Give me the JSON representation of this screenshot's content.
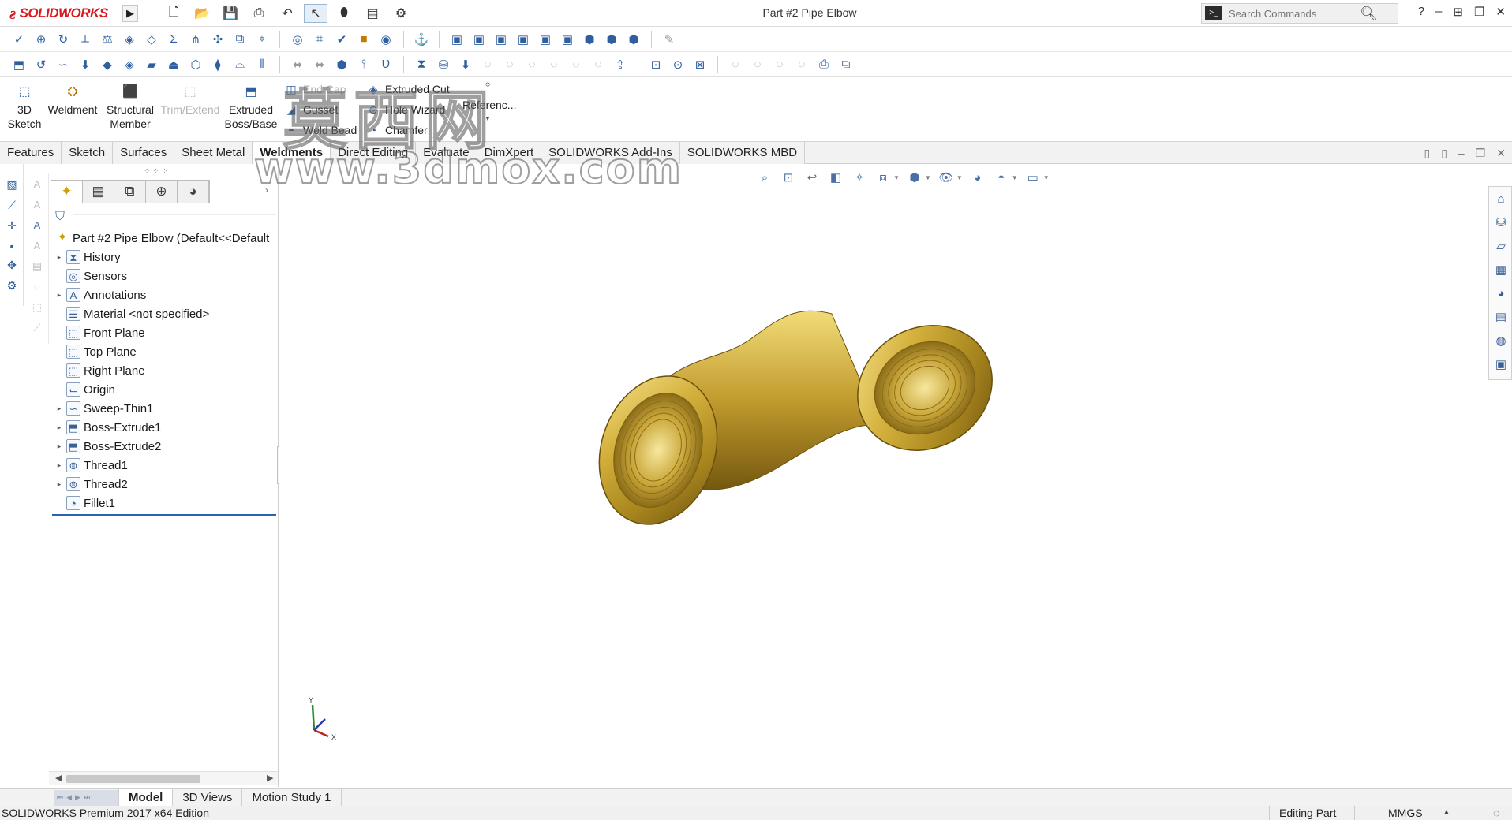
{
  "app": {
    "logo_brand": "SOLIDWORKS",
    "logo_mark": "ƨ",
    "document_title": "Part #2 Pipe Elbow"
  },
  "search": {
    "placeholder": "Search Commands"
  },
  "command_manager": {
    "sketch3d": "3D Sketch",
    "weldment": "Weldment",
    "structural_member": "Structural Member",
    "trim_extend": "Trim/Extend",
    "extruded_boss": "Extruded Boss/Base",
    "end_cap": "End Cap",
    "gusset": "Gusset",
    "weld_bead": "Weld Bead",
    "extruded_cut": "Extruded Cut",
    "hole_wizard": "Hole Wizard",
    "chamfer": "Chamfer",
    "reference": "Referenc..."
  },
  "tabs": [
    {
      "label": "Features",
      "active": false
    },
    {
      "label": "Sketch",
      "active": false
    },
    {
      "label": "Surfaces",
      "active": false
    },
    {
      "label": "Sheet Metal",
      "active": false
    },
    {
      "label": "Weldments",
      "active": true
    },
    {
      "label": "Direct Editing",
      "active": false
    },
    {
      "label": "Evaluate",
      "active": false
    },
    {
      "label": "DimXpert",
      "active": false
    },
    {
      "label": "SOLIDWORKS Add-Ins",
      "active": false
    },
    {
      "label": "SOLIDWORKS MBD",
      "active": false
    }
  ],
  "feature_tree": {
    "root": "Part #2 Pipe Elbow  (Default<<Default",
    "items": [
      {
        "label": "History",
        "icon": "history-icon",
        "expandable": true
      },
      {
        "label": "Sensors",
        "icon": "sensors-icon",
        "expandable": false
      },
      {
        "label": "Annotations",
        "icon": "annotations-icon",
        "expandable": true
      },
      {
        "label": "Material <not specified>",
        "icon": "material-icon",
        "expandable": false
      },
      {
        "label": "Front Plane",
        "icon": "plane-icon",
        "expandable": false
      },
      {
        "label": "Top Plane",
        "icon": "plane-icon",
        "expandable": false
      },
      {
        "label": "Right Plane",
        "icon": "plane-icon",
        "expandable": false
      },
      {
        "label": "Origin",
        "icon": "origin-icon",
        "expandable": false
      },
      {
        "label": "Sweep-Thin1",
        "icon": "sweep-icon",
        "expandable": true
      },
      {
        "label": "Boss-Extrude1",
        "icon": "extrude-icon",
        "expandable": true
      },
      {
        "label": "Boss-Extrude2",
        "icon": "extrude-icon",
        "expandable": true
      },
      {
        "label": "Thread1",
        "icon": "thread-icon",
        "expandable": true
      },
      {
        "label": "Thread2",
        "icon": "thread-icon",
        "expandable": true
      },
      {
        "label": "Fillet1",
        "icon": "fillet-icon",
        "expandable": false
      }
    ]
  },
  "watermark": {
    "chinese": "莫西网",
    "url": "www.3dmox.com"
  },
  "triad": {
    "x": "X",
    "y": "Y"
  },
  "bottom_tabs": [
    {
      "label": "Model",
      "active": true
    },
    {
      "label": "3D Views",
      "active": false
    },
    {
      "label": "Motion Study 1",
      "active": false
    }
  ],
  "status": {
    "left": "SOLIDWORKS Premium 2017 x64 Edition",
    "editing": "Editing Part",
    "units": "MMGS"
  },
  "colors": {
    "brand_red": "#d71920",
    "active_underline": "#2a62b8",
    "model_brass": "#c9a227"
  }
}
